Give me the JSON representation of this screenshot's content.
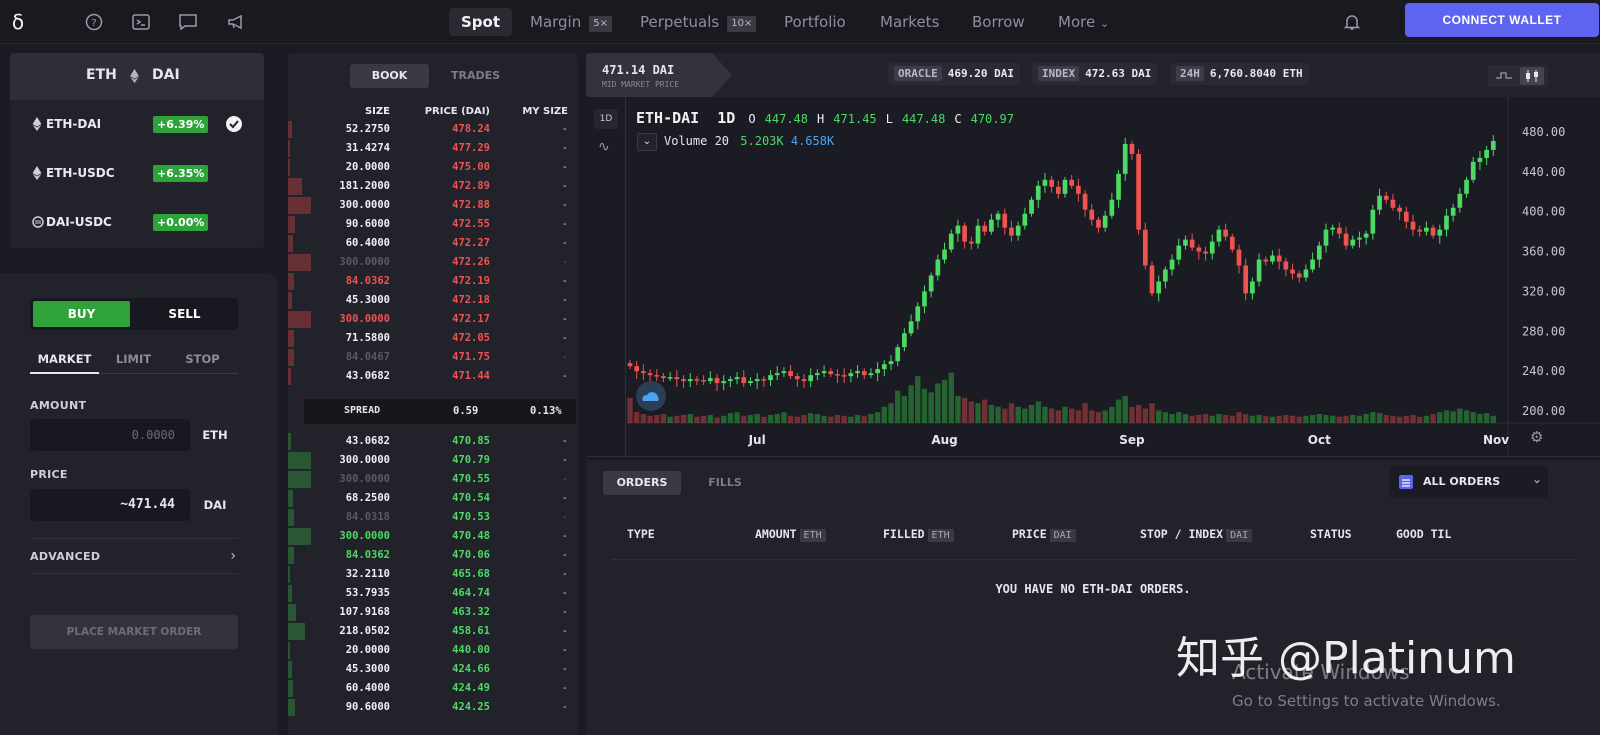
{
  "nav": {
    "logo": "δ",
    "items": [
      {
        "label": "Spot"
      },
      {
        "label": "Margin",
        "badge": "5×"
      },
      {
        "label": "Perpetuals",
        "badge": "10×"
      },
      {
        "label": "Portfolio"
      },
      {
        "label": "Markets"
      },
      {
        "label": "Borrow"
      },
      {
        "label": "More"
      }
    ],
    "connect": "CONNECT WALLET"
  },
  "pairs": {
    "header_base": "ETH",
    "header_quote": "DAI",
    "list": [
      {
        "name": "ETH-DAI",
        "change": "+6.39%"
      },
      {
        "name": "ETH-USDC",
        "change": "+6.35%"
      },
      {
        "name": "DAI-USDC",
        "change": "+0.00%"
      }
    ]
  },
  "trade": {
    "buy": "BUY",
    "sell": "SELL",
    "tabs": [
      "MARKET",
      "LIMIT",
      "STOP"
    ],
    "amount_label": "AMOUNT",
    "amount_placeholder": "0.0000",
    "amount_unit": "ETH",
    "price_label": "PRICE",
    "price_value": "~471.44",
    "price_unit": "DAI",
    "advanced": "ADVANCED",
    "place": "PLACE MARKET ORDER"
  },
  "orderbook": {
    "tabs": [
      "BOOK",
      "TRADES"
    ],
    "headers": [
      "SIZE",
      "PRICE (DAI)",
      "MY SIZE"
    ],
    "asks": [
      {
        "size": "52.2750",
        "price": "478.24",
        "my": "-",
        "depth": 0.1,
        "dim": false,
        "red": false
      },
      {
        "size": "31.4274",
        "price": "477.29",
        "my": "-",
        "depth": 0.06,
        "dim": false,
        "red": false
      },
      {
        "size": "20.0000",
        "price": "475.00",
        "my": "-",
        "depth": 0.04,
        "dim": false,
        "red": false
      },
      {
        "size": "181.2000",
        "price": "472.89",
        "my": "-",
        "depth": 0.35,
        "dim": false,
        "red": false
      },
      {
        "size": "300.0000",
        "price": "472.88",
        "my": "-",
        "depth": 0.58,
        "dim": false,
        "red": false
      },
      {
        "size": "90.6000",
        "price": "472.55",
        "my": "-",
        "depth": 0.18,
        "dim": false,
        "red": false
      },
      {
        "size": "60.4000",
        "price": "472.27",
        "my": "-",
        "depth": 0.12,
        "dim": false,
        "red": false
      },
      {
        "size": "300.0000",
        "price": "472.26",
        "my": "-",
        "depth": 0.58,
        "dim": true,
        "red": false
      },
      {
        "size": "84.0362",
        "price": "472.19",
        "my": "-",
        "depth": 0.16,
        "dim": false,
        "red": true
      },
      {
        "size": "45.3000",
        "price": "472.18",
        "my": "-",
        "depth": 0.09,
        "dim": false,
        "red": false
      },
      {
        "size": "300.0000",
        "price": "472.17",
        "my": "-",
        "depth": 0.58,
        "dim": false,
        "red": true
      },
      {
        "size": "71.5800",
        "price": "472.05",
        "my": "-",
        "depth": 0.14,
        "dim": false,
        "red": false
      },
      {
        "size": "84.0467",
        "price": "471.75",
        "my": "-",
        "depth": 0.16,
        "dim": true,
        "red": false
      },
      {
        "size": "43.0682",
        "price": "471.44",
        "my": "-",
        "depth": 0.08,
        "dim": false,
        "red": false
      }
    ],
    "spread": {
      "label": "SPREAD",
      "value": "0.59",
      "pct": "0.13%"
    },
    "bids": [
      {
        "size": "43.0682",
        "price": "470.85",
        "my": "-",
        "depth": 0.08,
        "dim": false,
        "grn": false
      },
      {
        "size": "300.0000",
        "price": "470.79",
        "my": "-",
        "depth": 0.58,
        "dim": false,
        "grn": false
      },
      {
        "size": "300.0000",
        "price": "470.55",
        "my": "-",
        "depth": 0.58,
        "dim": true,
        "grn": false
      },
      {
        "size": "68.2500",
        "price": "470.54",
        "my": "-",
        "depth": 0.13,
        "dim": false,
        "grn": false
      },
      {
        "size": "84.0318",
        "price": "470.53",
        "my": "-",
        "depth": 0.16,
        "dim": true,
        "grn": false
      },
      {
        "size": "300.0000",
        "price": "470.48",
        "my": "-",
        "depth": 0.58,
        "dim": false,
        "grn": true
      },
      {
        "size": "84.0362",
        "price": "470.06",
        "my": "-",
        "depth": 0.16,
        "dim": false,
        "grn": true
      },
      {
        "size": "32.2110",
        "price": "465.68",
        "my": "-",
        "depth": 0.06,
        "dim": false,
        "grn": false
      },
      {
        "size": "53.7935",
        "price": "464.74",
        "my": "-",
        "depth": 0.1,
        "dim": false,
        "grn": false
      },
      {
        "size": "107.9168",
        "price": "463.32",
        "my": "-",
        "depth": 0.21,
        "dim": false,
        "grn": false
      },
      {
        "size": "218.0502",
        "price": "458.61",
        "my": "-",
        "depth": 0.42,
        "dim": false,
        "grn": false
      },
      {
        "size": "20.0000",
        "price": "440.00",
        "my": "-",
        "depth": 0.04,
        "dim": false,
        "grn": false
      },
      {
        "size": "45.3000",
        "price": "424.66",
        "my": "-",
        "depth": 0.09,
        "dim": false,
        "grn": false
      },
      {
        "size": "60.4000",
        "price": "424.49",
        "my": "-",
        "depth": 0.12,
        "dim": false,
        "grn": false
      },
      {
        "size": "90.6000",
        "price": "424.25",
        "my": "-",
        "depth": 0.18,
        "dim": false,
        "grn": false
      }
    ]
  },
  "ticker": {
    "price": "471.14 DAI",
    "sub": "MID MARKET PRICE",
    "oracle_tag": "ORACLE",
    "oracle": "469.20 DAI",
    "index_tag": "INDEX",
    "index": "472.63 DAI",
    "vol_tag": "24H",
    "vol": "6,760.8040 ETH"
  },
  "chart": {
    "interval_btn": "1D",
    "title": "ETH-DAI",
    "interval": "1D",
    "o_label": "O",
    "o": "447.48",
    "h_label": "H",
    "h": "471.45",
    "l_label": "L",
    "l": "447.48",
    "c_label": "C",
    "c": "470.97",
    "vol_label": "Volume 20",
    "vol_a": "5.203K",
    "vol_b": "4.658K"
  },
  "chart_data": {
    "type": "candlestick",
    "y_ticks": [
      "480.00",
      "440.00",
      "400.00",
      "360.00",
      "320.00",
      "280.00",
      "240.00",
      "200.00"
    ],
    "ylim": [
      200,
      480
    ],
    "x_ticks": [
      "Jul",
      "Aug",
      "Sep",
      "Oct",
      "Nov"
    ],
    "close": [
      245,
      240,
      238,
      236,
      235,
      233,
      234,
      232,
      230,
      232,
      231,
      230,
      233,
      228,
      230,
      232,
      234,
      228,
      230,
      232,
      231,
      236,
      238,
      240,
      235,
      232,
      230,
      236,
      238,
      240,
      237,
      236,
      235,
      238,
      240,
      236,
      238,
      242,
      247,
      250,
      264,
      278,
      290,
      305,
      320,
      336,
      352,
      362,
      378,
      386,
      370,
      368,
      386,
      380,
      392,
      398,
      384,
      376,
      386,
      398,
      412,
      426,
      432,
      425,
      418,
      432,
      426,
      418,
      402,
      392,
      384,
      396,
      412,
      438,
      468,
      458,
      382,
      346,
      318,
      330,
      342,
      352,
      366,
      372,
      364,
      360,
      358,
      370,
      382,
      375,
      362,
      346,
      318,
      330,
      352,
      350,
      356,
      350,
      342,
      338,
      334,
      342,
      352,
      366,
      382,
      384,
      378,
      366,
      372,
      374,
      378,
      402,
      416,
      412,
      404,
      400,
      390,
      382,
      380,
      384,
      376,
      382,
      396,
      404,
      418,
      432,
      450,
      454,
      462,
      471
    ],
    "volume": [
      0.28,
      0.12,
      0.1,
      0.08,
      0.09,
      0.1,
      0.07,
      0.08,
      0.09,
      0.1,
      0.07,
      0.08,
      0.09,
      0.06,
      0.08,
      0.11,
      0.12,
      0.08,
      0.09,
      0.1,
      0.07,
      0.09,
      0.1,
      0.12,
      0.08,
      0.07,
      0.09,
      0.11,
      0.1,
      0.08,
      0.07,
      0.09,
      0.08,
      0.07,
      0.09,
      0.08,
      0.1,
      0.12,
      0.18,
      0.22,
      0.36,
      0.3,
      0.42,
      0.52,
      0.38,
      0.34,
      0.44,
      0.48,
      0.56,
      0.3,
      0.28,
      0.24,
      0.22,
      0.26,
      0.2,
      0.18,
      0.16,
      0.22,
      0.18,
      0.16,
      0.2,
      0.24,
      0.18,
      0.16,
      0.14,
      0.18,
      0.16,
      0.14,
      0.22,
      0.14,
      0.12,
      0.14,
      0.18,
      0.26,
      0.3,
      0.18,
      0.2,
      0.16,
      0.22,
      0.14,
      0.12,
      0.1,
      0.12,
      0.1,
      0.08,
      0.09,
      0.1,
      0.08,
      0.1,
      0.09,
      0.08,
      0.12,
      0.1,
      0.08,
      0.09,
      0.08,
      0.07,
      0.08,
      0.09,
      0.08,
      0.07,
      0.08,
      0.09,
      0.1,
      0.09,
      0.08,
      0.07,
      0.08,
      0.09,
      0.08,
      0.1,
      0.12,
      0.11,
      0.09,
      0.08,
      0.07,
      0.08,
      0.09,
      0.07,
      0.08,
      0.1,
      0.12,
      0.14,
      0.13,
      0.16,
      0.14,
      0.12,
      0.1,
      0.11,
      0.08
    ]
  },
  "orders": {
    "tabs": [
      "ORDERS",
      "FILLS"
    ],
    "filter": "ALL ORDERS",
    "columns": [
      {
        "name": "TYPE",
        "unit": ""
      },
      {
        "name": "AMOUNT",
        "unit": "ETH"
      },
      {
        "name": "FILLED",
        "unit": "ETH"
      },
      {
        "name": "PRICE",
        "unit": "DAI"
      },
      {
        "name": "STOP / INDEX",
        "unit": "DAI"
      },
      {
        "name": "STATUS",
        "unit": ""
      },
      {
        "name": "GOOD TIL",
        "unit": ""
      }
    ],
    "empty": "YOU HAVE NO ETH-DAI ORDERS."
  },
  "watermark": {
    "line1": "Activate Windows",
    "line2": "Go to Settings to activate Windows.",
    "brand": "知乎 @Platinum"
  },
  "colors": {
    "up": "#4cd964",
    "down": "#ef5350",
    "accent": "#5e64f0",
    "bg": "#1b1b23"
  }
}
